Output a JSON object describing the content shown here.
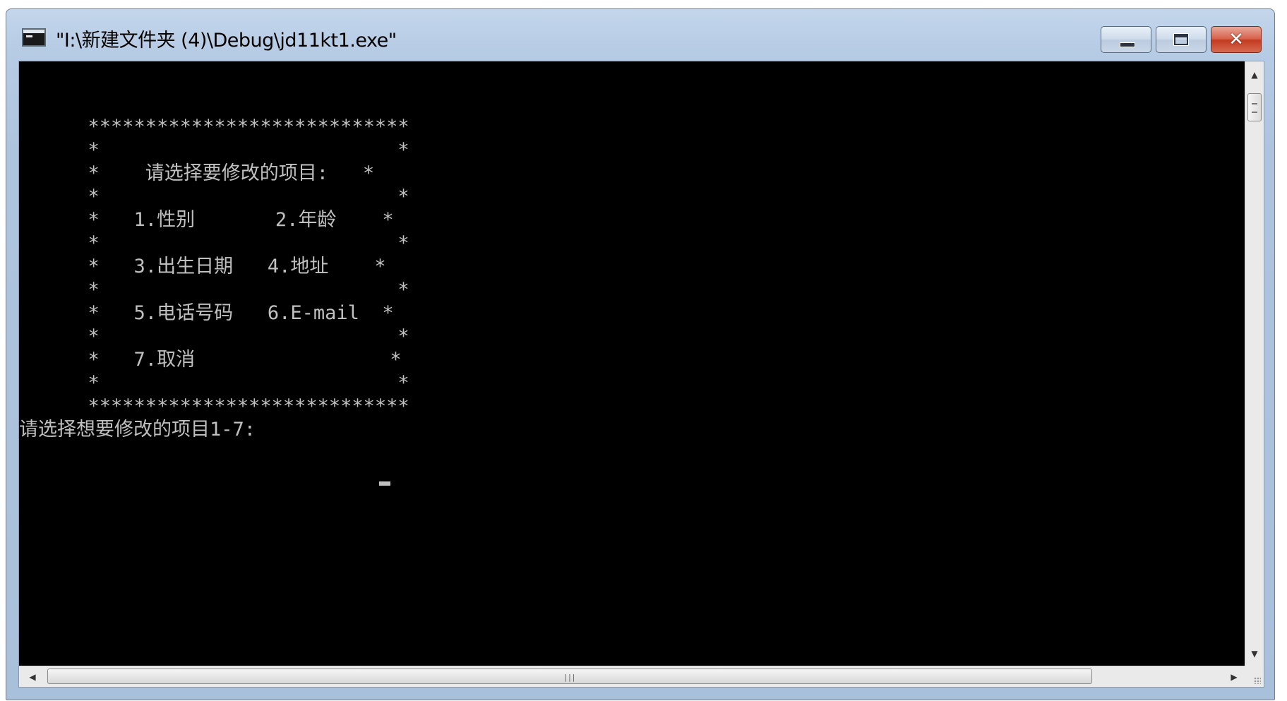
{
  "window": {
    "title": "\"I:\\新建文件夹 (4)\\Debug\\jd11kt1.exe\"",
    "icon": "console-app-icon",
    "caption_buttons": {
      "minimize": "minimize-icon",
      "maximize": "maximize-icon",
      "close": "✕"
    }
  },
  "console": {
    "lines": [
      "      ****************************",
      "      *                          *",
      "      *    请选择要修改的项目:   *",
      "      *                          *",
      "      *   1.性别       2.年龄    *",
      "      *                          *",
      "      *   3.出生日期   4.地址    *",
      "      *                          *",
      "      *   5.电话号码   6.E-mail  *",
      "      *                          *",
      "      *   7.取消                 *",
      "      *                          *",
      "      ****************************",
      "请选择想要修改的项目1-7: "
    ],
    "text_color": "#c0c0c0",
    "background": "#000000"
  },
  "scrollbars": {
    "vertical": {
      "up": "▲",
      "down": "▼"
    },
    "horizontal": {
      "left": "◀",
      "right": "▶",
      "grip": "|||"
    }
  }
}
